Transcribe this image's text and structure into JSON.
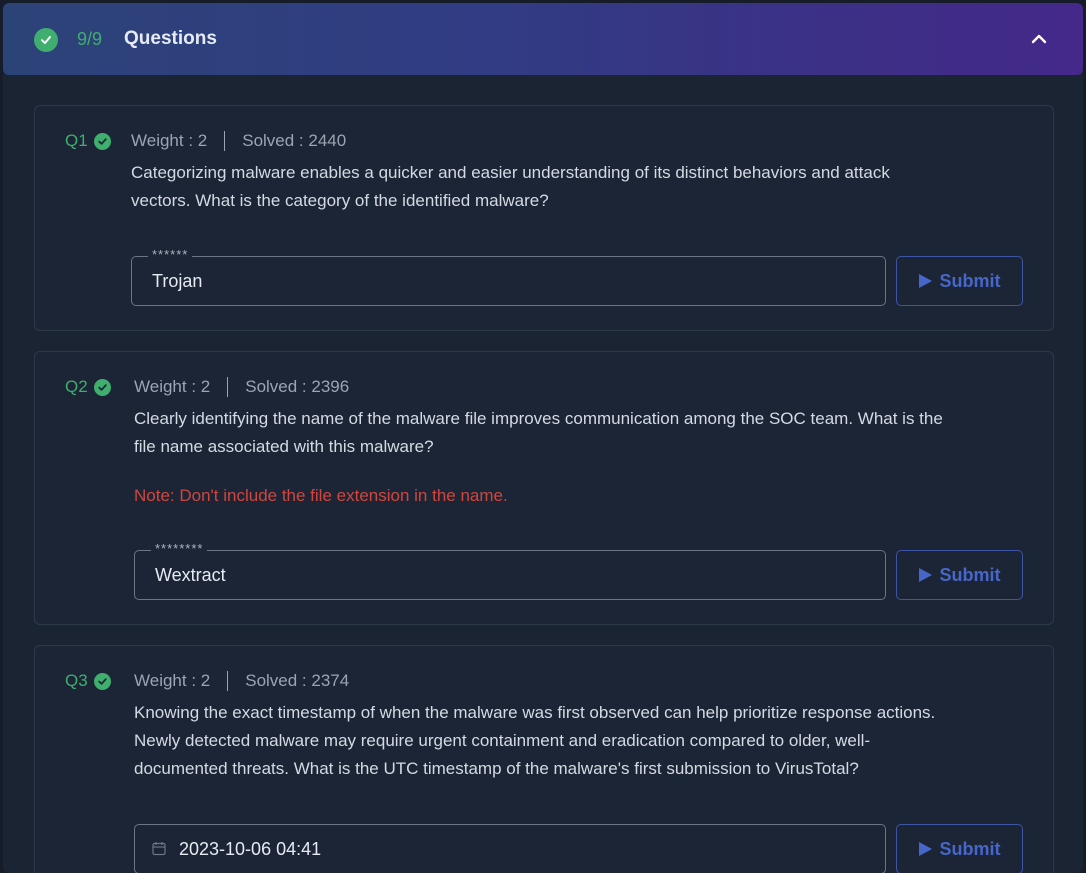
{
  "header": {
    "progress": "9/9",
    "title": "Questions"
  },
  "questions": [
    {
      "id": "Q1",
      "weight": "Weight : 2",
      "solved": "Solved : 2440",
      "text_lines": [
        "Categorizing malware enables a quicker and easier understanding of its distinct behaviors and attack",
        "vectors. What is the category of the identified malware?"
      ],
      "note": "",
      "answer_mask": "******",
      "answer": "Trojan",
      "submit_label": "Submit"
    },
    {
      "id": "Q2",
      "weight": "Weight : 2",
      "solved": "Solved : 2396",
      "text_lines": [
        "Clearly identifying the name of the malware file improves communication among the SOC team. What is the",
        "file name associated with this malware?"
      ],
      "note": "Note: Don't include the file extension in the name.",
      "answer_mask": "********",
      "answer": "Wextract",
      "submit_label": "Submit"
    },
    {
      "id": "Q3",
      "weight": "Weight : 2",
      "solved": "Solved : 2374",
      "text_lines": [
        "Knowing the exact timestamp of when the malware was first observed can help prioritize response actions.",
        "Newly detected malware may require urgent containment and eradication compared to older, well-",
        "documented threats. What is the UTC timestamp of the malware's first submission to VirusTotal?"
      ],
      "note": "",
      "answer_mask": "",
      "answer": "2023-10-06 04:41",
      "submit_label": "Submit"
    }
  ],
  "colors": {
    "accent_green": "#3fae6e",
    "note_red": "#d2453c",
    "submit_blue": "#4667c9"
  },
  "icons": {
    "header_check": "check-circle-icon",
    "collapse": "chevron-up-icon",
    "question_check": "check-circle-icon",
    "submit": "play-icon",
    "date": "calendar-icon"
  }
}
